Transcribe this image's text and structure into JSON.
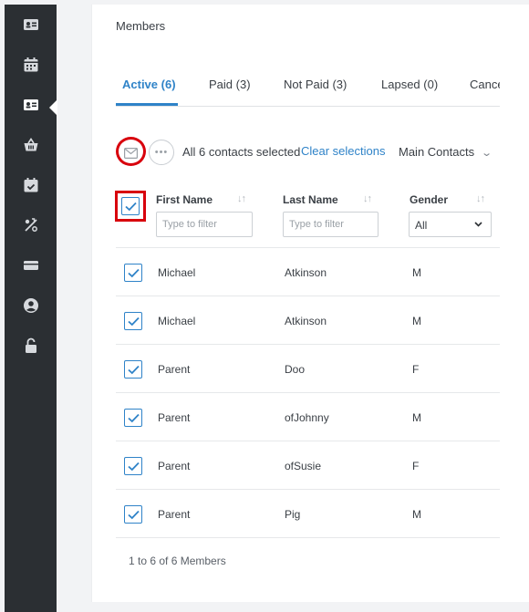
{
  "sidebar": {
    "items": [
      {
        "icon": "contact-card-icon"
      },
      {
        "icon": "calendar-icon"
      },
      {
        "icon": "members-card-icon",
        "active": true
      },
      {
        "icon": "basket-icon"
      },
      {
        "icon": "calendar-check-icon"
      },
      {
        "icon": "percent-tag-icon"
      },
      {
        "icon": "ticket-icon"
      },
      {
        "icon": "user-circle-icon"
      },
      {
        "icon": "unlock-icon"
      }
    ]
  },
  "page": {
    "title": "Members"
  },
  "tabs": [
    {
      "label": "Active (6)",
      "active": true
    },
    {
      "label": "Paid (3)"
    },
    {
      "label": "Not Paid (3)"
    },
    {
      "label": "Lapsed (0)"
    },
    {
      "label": "Cancelled"
    }
  ],
  "toolbar": {
    "mail_icon": "envelope-icon",
    "more_label": "•••",
    "selection_text": "All 6 contacts selected",
    "clear_label": "Clear selections",
    "view_select": "Main Contacts"
  },
  "table": {
    "columns": [
      {
        "label": "First Name",
        "filter_placeholder": "Type to filter"
      },
      {
        "label": "Last Name",
        "filter_placeholder": "Type to filter"
      },
      {
        "label": "Gender",
        "filter_value": "All"
      }
    ],
    "rows": [
      {
        "first": "Michael",
        "last": "Atkinson",
        "gender": "M",
        "checked": true
      },
      {
        "first": "Michael",
        "last": "Atkinson",
        "gender": "M",
        "checked": true
      },
      {
        "first": "Parent",
        "last": "Doo",
        "gender": "F",
        "checked": true
      },
      {
        "first": "Parent",
        "last": "ofJohnny",
        "gender": "M",
        "checked": true
      },
      {
        "first": "Parent",
        "last": "ofSusie",
        "gender": "F",
        "checked": true
      },
      {
        "first": "Parent",
        "last": "Pig",
        "gender": "M",
        "checked": true
      }
    ],
    "footer": "1 to 6 of 6 Members"
  },
  "colors": {
    "accent": "#2f83c8",
    "highlight": "#d8000c",
    "sidebar": "#2b2f33"
  }
}
